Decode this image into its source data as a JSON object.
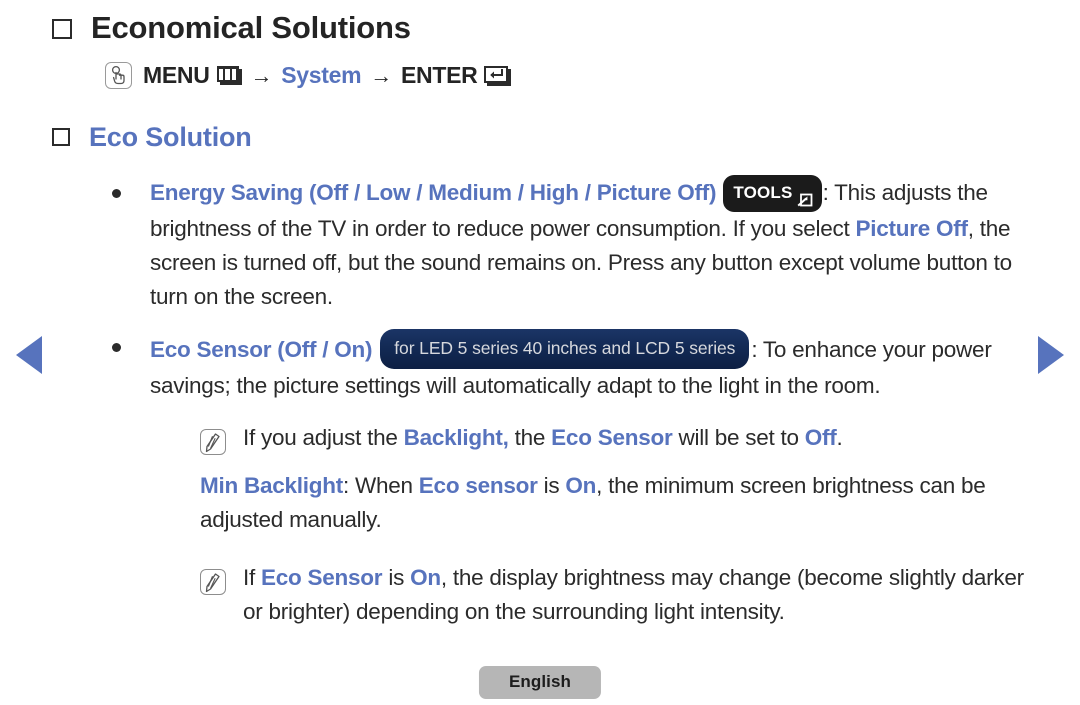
{
  "nav": {
    "prev_icon": "triangle-left-icon",
    "next_icon": "triangle-right-icon",
    "arrow_color": "#5773bd"
  },
  "heading": {
    "title": "Economical Solutions",
    "subtitle": "Eco Solution",
    "subtitle_color": "#5773bd"
  },
  "menu_path": {
    "hand_icon": "hand-press-icon",
    "menu_label": "MENU",
    "menu_icon": "menu-grid-icon",
    "arrow1": "→",
    "system_label": "System",
    "arrow2": "→",
    "enter_label": "ENTER",
    "enter_icon": "enter-key-icon"
  },
  "sections": {
    "energy_saving": {
      "term": "Energy Saving (Off / Low / Medium / High / Picture Off)",
      "badge": "TOOLS",
      "badge_icon": "tools-arrow-icon",
      "text_1": ": This adjusts the brightness of the TV in order to reduce power consumption. If you select ",
      "highlight_1": "Picture Off",
      "text_2": ", the screen is turned off, but the sound remains on. Press any button except volume button to turn on the screen."
    },
    "eco_sensor": {
      "term": "Eco Sensor (Off / On)",
      "model_badge": "for LED 5 series 40 inches and LCD 5 series",
      "text_1": ": To enhance your power savings; the picture settings will automatically adapt to the light in the room."
    }
  },
  "notes": [
    {
      "icon": "note-pencil-icon",
      "part_1": "If you adjust the ",
      "highlight_1": "Backlight,",
      "part_2": " the ",
      "highlight_2": "Eco Sensor",
      "part_3": " will be set to ",
      "highlight_3": "Off",
      "part_4": "."
    },
    {
      "icon": "note-pencil-icon",
      "part_1": "If ",
      "highlight_1": "Eco Sensor",
      "part_2": " is ",
      "highlight_2": "On",
      "part_3": ", the display brightness may change (become slightly darker or brighter) depending on the surrounding light intensity.",
      "part_4": ""
    }
  ],
  "min_backlight": {
    "term": "Min Backlight",
    "part_1": ": When ",
    "highlight_1": "Eco sensor",
    "part_2": " is ",
    "highlight_2": "On",
    "part_3": ", the minimum screen brightness can be adjusted manually."
  },
  "footer": {
    "language": "English"
  }
}
